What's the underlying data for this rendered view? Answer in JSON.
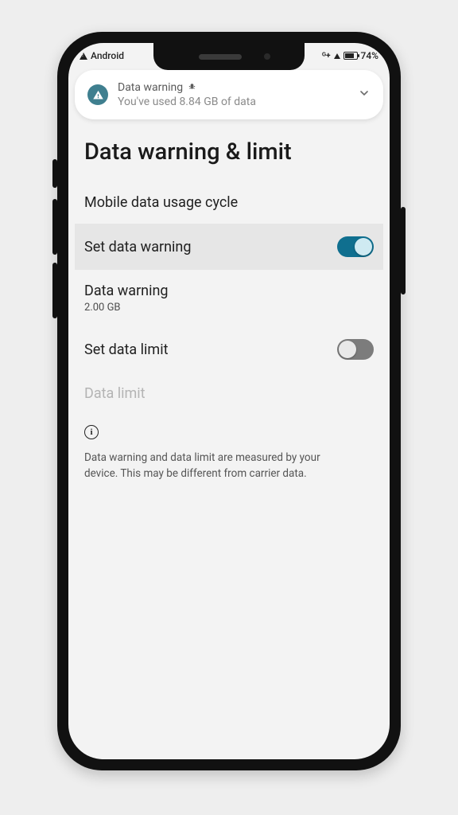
{
  "status_bar": {
    "left_label": "Android",
    "net_label": "+",
    "battery_pct": "74%"
  },
  "notification": {
    "title": "Data warning",
    "subtitle": "You've used 8.84 GB of data"
  },
  "page": {
    "title": "Data warning & limit"
  },
  "settings": {
    "usage_cycle_label": "Mobile data usage cycle",
    "set_warning_label": "Set data warning",
    "set_warning_on": true,
    "data_warning_label": "Data warning",
    "data_warning_value": "2.00 GB",
    "set_limit_label": "Set data limit",
    "set_limit_on": false,
    "data_limit_label": "Data limit"
  },
  "info": {
    "text": "Data warning and data limit are measured by your device. This may be different from carrier data."
  }
}
